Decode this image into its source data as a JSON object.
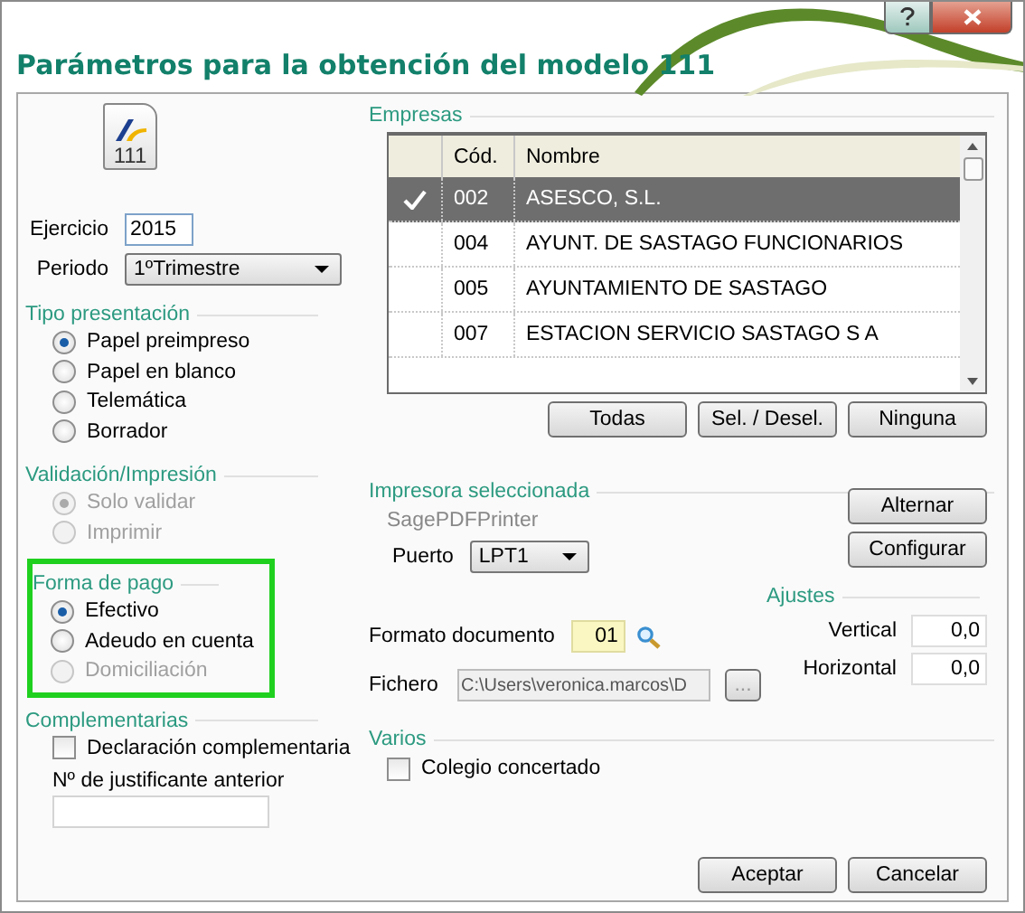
{
  "window": {
    "title": "Parámetros para la obtención del modelo 111"
  },
  "title_buttons": [
    {
      "kind": "help"
    },
    {
      "kind": "close"
    }
  ],
  "form_icon": {
    "label": "111"
  },
  "ejercicio": {
    "label": "Ejercicio",
    "value": "2015"
  },
  "periodo": {
    "label": "Periodo",
    "value": "1ºTrimestre"
  },
  "tipo_presentacion": {
    "title": "Tipo presentación",
    "options": [
      {
        "label": "Papel preimpreso",
        "selected": true,
        "disabled": false
      },
      {
        "label": "Papel en blanco",
        "selected": false,
        "disabled": false
      },
      {
        "label": "Telemática",
        "selected": false,
        "disabled": false
      },
      {
        "label": "Borrador",
        "selected": false,
        "disabled": false
      }
    ]
  },
  "validacion": {
    "title": "Validación/Impresión",
    "options": [
      {
        "label": "Solo validar",
        "selected": true,
        "disabled": true
      },
      {
        "label": "Imprimir",
        "selected": false,
        "disabled": true
      }
    ]
  },
  "forma_de_pago": {
    "title": "Forma de pago",
    "highlighted": true,
    "options": [
      {
        "label": "Efectivo",
        "selected": true,
        "disabled": false
      },
      {
        "label": "Adeudo en cuenta",
        "selected": false,
        "disabled": false
      },
      {
        "label": "Domiciliación",
        "selected": false,
        "disabled": true
      }
    ]
  },
  "complementarias": {
    "title": "Complementarias",
    "checkbox": {
      "label": "Declaración complementaria",
      "checked": false
    },
    "justificante": {
      "label": "Nº de justificante anterior"
    }
  },
  "empresas": {
    "title": "Empresas",
    "columns": [
      "Cód.",
      "Nombre"
    ],
    "rows": [
      {
        "code": "002",
        "name": "ASESCO, S.L.",
        "selected": true
      },
      {
        "code": "004",
        "name": "AYUNT. DE SASTAGO FUNCIONARIOS",
        "selected": false
      },
      {
        "code": "005",
        "name": "AYUNTAMIENTO DE SASTAGO",
        "selected": false
      },
      {
        "code": "007",
        "name": "ESTACION SERVICIO SASTAGO S A",
        "selected": false
      }
    ],
    "buttons": [
      "Todas",
      "Sel. / Desel.",
      "Ninguna"
    ]
  },
  "impresora": {
    "title": "Impresora seleccionada",
    "printer": "SagePDFPrinter",
    "port_label": "Puerto",
    "port": "LPT1",
    "buttons": [
      "Alternar",
      "Configurar"
    ]
  },
  "formato": {
    "label": "Formato documento",
    "value": "01"
  },
  "fichero": {
    "label": "Fichero",
    "value": "C:\\Users\\veronica.marcos\\D",
    "browse": "..."
  },
  "ajustes": {
    "title": "Ajustes",
    "fields": [
      {
        "label": "Vertical",
        "value": "0,0"
      },
      {
        "label": "Horizontal",
        "value": "0,0"
      }
    ]
  },
  "varios": {
    "title": "Varios",
    "checkbox": {
      "label": "Colegio concertado",
      "checked": false
    }
  },
  "footer_buttons": [
    "Aceptar",
    "Cancelar"
  ]
}
